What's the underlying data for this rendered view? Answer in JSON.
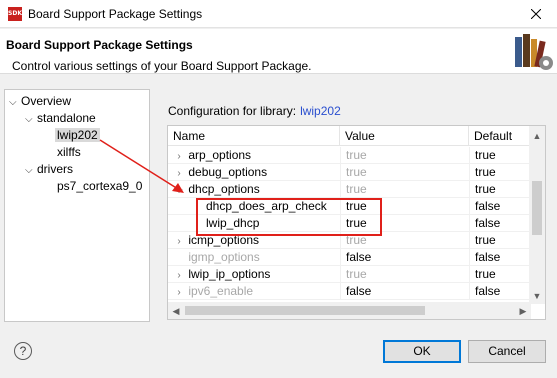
{
  "window": {
    "title": "Board Support Package Settings",
    "app_icon_text": "SDK"
  },
  "header": {
    "title": "Board Support Package Settings",
    "description": "Control various settings of your Board Support Package."
  },
  "tree": {
    "overview": "Overview",
    "standalone": "standalone",
    "lwip202": "lwip202",
    "xilffs": "xilffs",
    "drivers": "drivers",
    "ps7": "ps7_cortexa9_0"
  },
  "config": {
    "label": "Configuration for library:",
    "library": "lwip202"
  },
  "table": {
    "headers": {
      "name": "Name",
      "value": "Value",
      "default": "Default"
    },
    "rows": [
      {
        "name": "arp_options",
        "value": "true",
        "default": "true"
      },
      {
        "name": "debug_options",
        "value": "true",
        "default": "true"
      },
      {
        "name": "dhcp_options",
        "value": "true",
        "default": "true"
      },
      {
        "name": "dhcp_does_arp_check",
        "value": "true",
        "default": "false"
      },
      {
        "name": "lwip_dhcp",
        "value": "true",
        "default": "false"
      },
      {
        "name": "icmp_options",
        "value": "true",
        "default": "true"
      },
      {
        "name": "igmp_options",
        "value": "false",
        "default": "false"
      },
      {
        "name": "lwip_ip_options",
        "value": "true",
        "default": "true"
      },
      {
        "name": "ipv6_enable",
        "value": "false",
        "default": "false"
      }
    ]
  },
  "buttons": {
    "help": "?",
    "ok": "OK",
    "cancel": "Cancel"
  },
  "colors": {
    "annotation": "#e0201a",
    "link": "#2a4fcf",
    "ok_focus": "#0078d7"
  }
}
